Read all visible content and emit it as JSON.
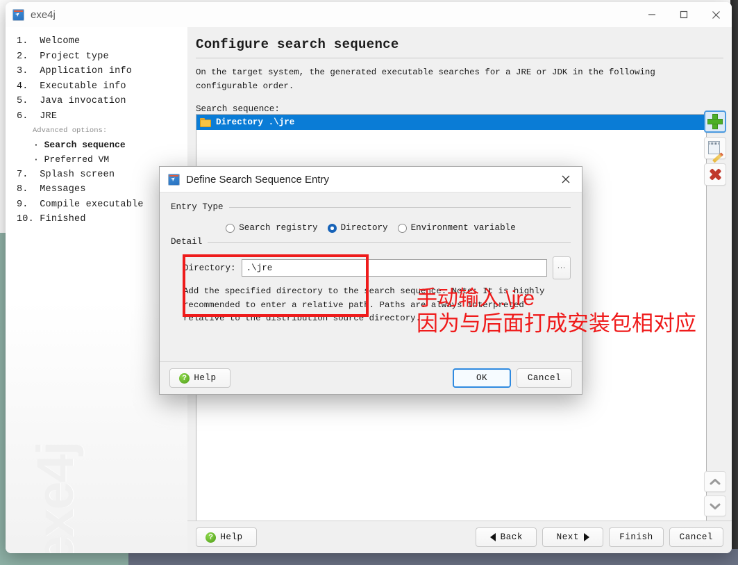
{
  "desktop": {
    "bg_color": "#8fb3a8",
    "taskbar_color": "#6b7285"
  },
  "window": {
    "title": "exe4j",
    "icon": "exe4j-app-icon",
    "controls": {
      "minimize": "minimize-icon",
      "maximize": "maximize-icon",
      "close": "close-icon"
    },
    "watermark": "exe4j"
  },
  "sidebar": {
    "steps": [
      {
        "num": "1.",
        "label": "Welcome"
      },
      {
        "num": "2.",
        "label": "Project type"
      },
      {
        "num": "3.",
        "label": "Application info"
      },
      {
        "num": "4.",
        "label": "Executable info"
      },
      {
        "num": "5.",
        "label": "Java invocation"
      },
      {
        "num": "6.",
        "label": "JRE"
      }
    ],
    "advanced_header": "Advanced options:",
    "substeps": [
      {
        "label": "Search sequence",
        "selected": true
      },
      {
        "label": "Preferred VM",
        "selected": false
      }
    ],
    "steps_after": [
      {
        "num": "7.",
        "label": "Splash screen"
      },
      {
        "num": "8.",
        "label": "Messages"
      },
      {
        "num": "9.",
        "label": "Compile executable"
      },
      {
        "num": "10.",
        "label": "Finished"
      }
    ]
  },
  "main": {
    "title": "Configure search sequence",
    "description": "On the target system, the generated executable searches for a JRE or JDK in the following configurable order.",
    "list_label": "Search sequence:",
    "list_items": [
      {
        "icon": "folder-icon",
        "text": "Directory .\\jre",
        "selected": true
      }
    ],
    "toolbar": [
      {
        "name": "add-entry-button",
        "icon": "plus-icon",
        "focused": true
      },
      {
        "name": "edit-entry-button",
        "icon": "pencil-edit-icon",
        "focused": false
      },
      {
        "name": "delete-entry-button",
        "icon": "red-x-icon",
        "focused": false
      }
    ],
    "reorder": [
      {
        "name": "move-up-button",
        "icon": "chevron-up-icon"
      },
      {
        "name": "move-down-button",
        "icon": "chevron-down-icon"
      }
    ],
    "buttons": {
      "help": "Help",
      "back": "Back",
      "next": "Next",
      "finish": "Finish",
      "cancel": "Cancel"
    }
  },
  "dialog": {
    "title": "Define Search Sequence Entry",
    "icon": "exe4j-app-icon",
    "close_icon": "close-icon",
    "entry_type_label": "Entry Type",
    "radios": [
      {
        "label": "Search registry",
        "selected": false
      },
      {
        "label": "Directory",
        "selected": true
      },
      {
        "label": "Environment variable",
        "selected": false
      }
    ],
    "detail_label": "Detail",
    "directory_label": "Directory:",
    "directory_value": ".\\jre",
    "browse_label": "...",
    "description": "Add the specified directory to the search sequence. Note: It is highly recommended to enter a relative path. Paths are always interpreted relative to the distribution source directory.",
    "buttons": {
      "help": "Help",
      "ok": "OK",
      "cancel": "Cancel"
    }
  },
  "annotations": {
    "highlight_color": "#ee1b1b",
    "note1": "手动输入.\\jre",
    "note2": "因为与后面打成安装包相对应"
  }
}
